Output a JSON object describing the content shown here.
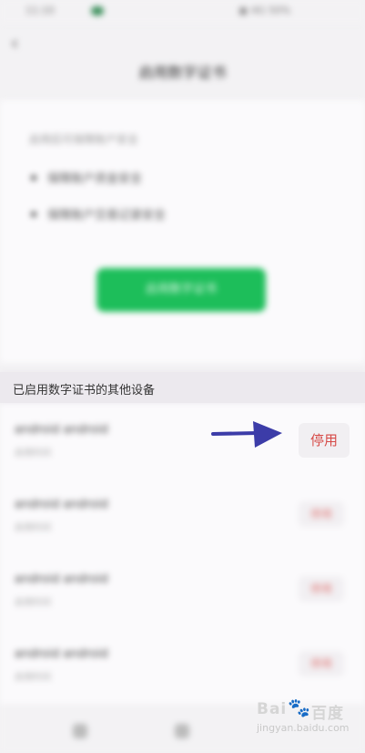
{
  "status_bar": {
    "time": "11:10",
    "right": "▣ 4G 50%"
  },
  "header": {
    "title": "启用数字证书"
  },
  "card": {
    "description": "启用后可保障账户安全",
    "bullets": [
      "保障账户资金安全",
      "保障账户交易记录安全"
    ],
    "button_label": "启用数字证书"
  },
  "section": {
    "title": "已启用数字证书的其他设备"
  },
  "devices": [
    {
      "name": "android android",
      "sub": "启用时间",
      "button": "停用"
    },
    {
      "name": "android android",
      "sub": "启用时间",
      "button": "停用"
    },
    {
      "name": "android android",
      "sub": "启用时间",
      "button": "停用"
    },
    {
      "name": "android android",
      "sub": "启用时间",
      "button": "停用"
    }
  ],
  "highlight_button": {
    "label": "停用"
  },
  "annotation": {
    "arrow_color": "#3c3ca8"
  },
  "watermark": {
    "logo": "Bai",
    "logo_suffix": "百度",
    "sub": "jingyan.baidu.com"
  },
  "colors": {
    "accent_green": "#1dbe5a",
    "danger_red": "#d64a47"
  }
}
